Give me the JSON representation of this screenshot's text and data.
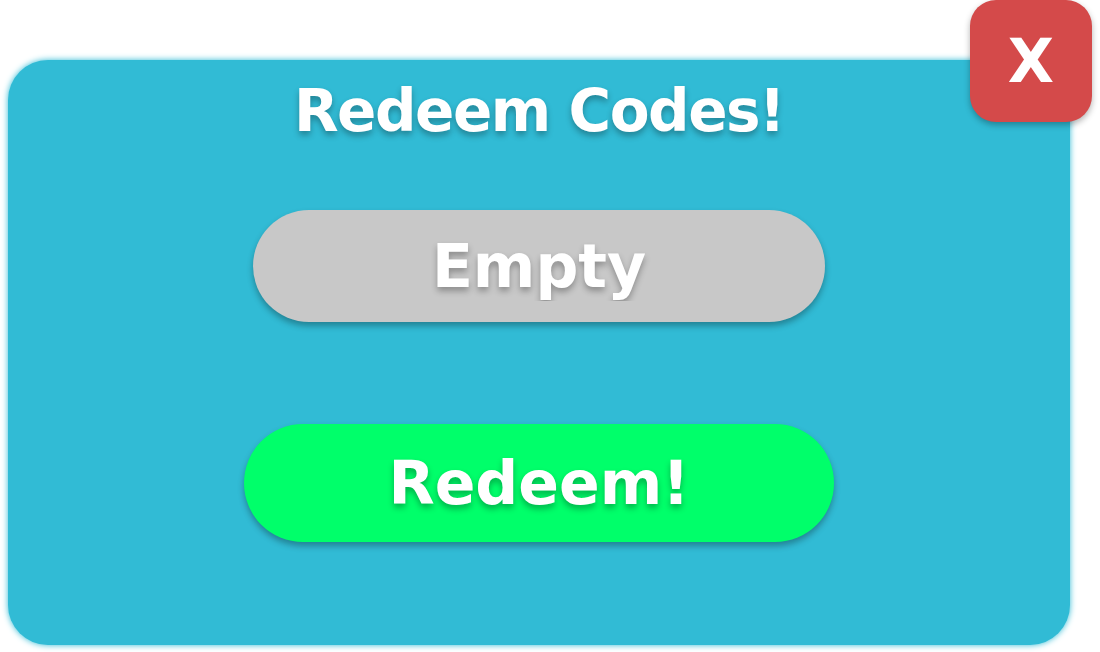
{
  "dialog": {
    "title": "Redeem Codes!"
  },
  "close_button": {
    "label": "X"
  },
  "code_field": {
    "placeholder": "Empty"
  },
  "redeem_button": {
    "label": "Redeem!"
  }
}
